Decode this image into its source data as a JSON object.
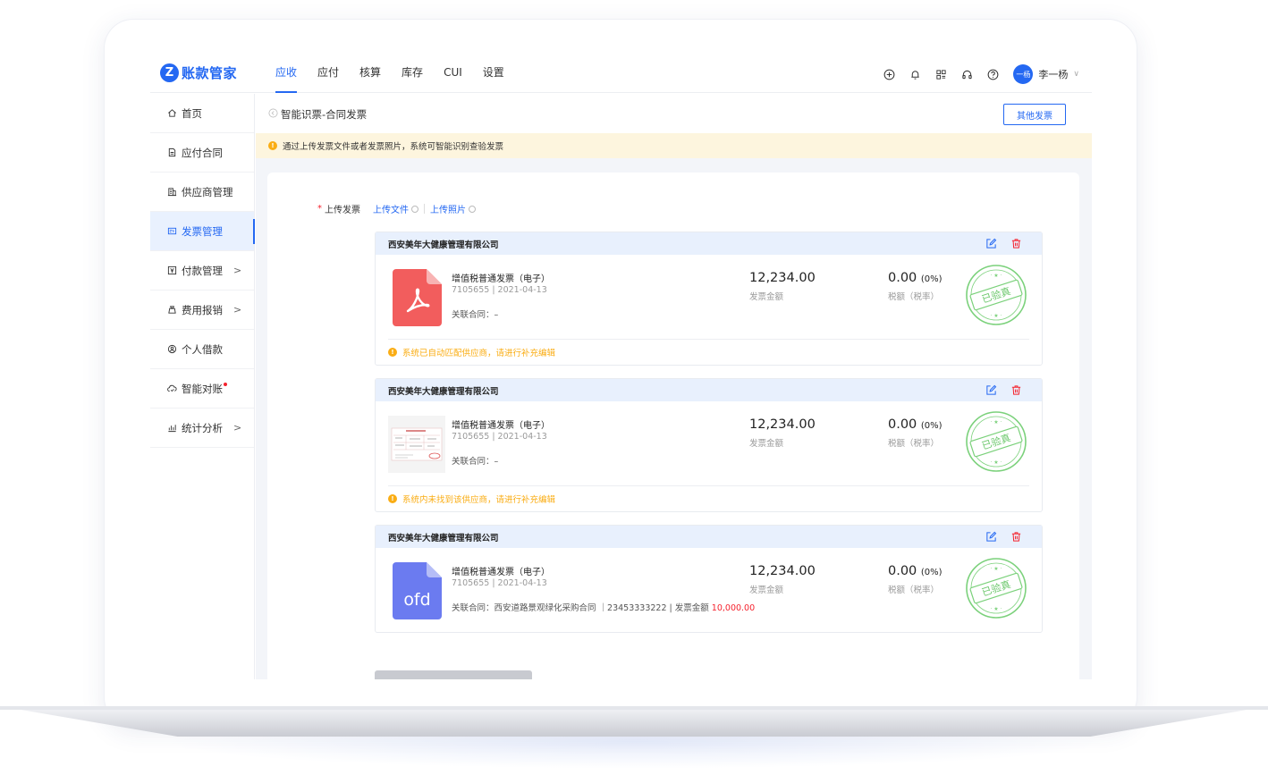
{
  "logo": {
    "mark": "Z",
    "text": "账款管家"
  },
  "nav": {
    "tabs": [
      {
        "label": "应收",
        "active": true
      },
      {
        "label": "应付",
        "active": false
      },
      {
        "label": "核算",
        "active": false
      },
      {
        "label": "库存",
        "active": false
      },
      {
        "label": "CUI",
        "active": false
      },
      {
        "label": "设置",
        "active": false
      }
    ],
    "icons": [
      "add-circle-icon",
      "bell-icon",
      "apps-icon",
      "headset-icon",
      "help-icon"
    ],
    "avatar_text": "一杨",
    "username": "李一杨",
    "caret": "∨"
  },
  "sidebar": {
    "items": [
      {
        "label": "首页",
        "icon": "home-icon",
        "arrow": "",
        "badge": false,
        "active": false
      },
      {
        "label": "应付合同",
        "icon": "document-icon",
        "arrow": "",
        "badge": false,
        "active": false
      },
      {
        "label": "供应商管理",
        "icon": "building-icon",
        "arrow": "",
        "badge": false,
        "active": false
      },
      {
        "label": "发票管理",
        "icon": "invoice-icon",
        "arrow": "",
        "badge": false,
        "active": true
      },
      {
        "label": "付款管理",
        "icon": "yen-icon",
        "arrow": ">",
        "badge": false,
        "active": false
      },
      {
        "label": "费用报销",
        "icon": "wallet-icon",
        "arrow": ">",
        "badge": false,
        "active": false
      },
      {
        "label": "个人借款",
        "icon": "person-money-icon",
        "arrow": "",
        "badge": false,
        "active": false
      },
      {
        "label": "智能对账",
        "icon": "cloud-check-icon",
        "arrow": "",
        "badge": true,
        "active": false
      },
      {
        "label": "统计分析",
        "icon": "chart-icon",
        "arrow": ">",
        "badge": false,
        "active": false
      }
    ]
  },
  "header": {
    "title": "智能识票-合同发票",
    "other_button": "其他发票"
  },
  "notice": {
    "icon": "!",
    "text": "通过上传发票文件或者发票照片，系统可智能识别查验发票"
  },
  "upload": {
    "required_mark": "*",
    "label": "上传发票",
    "file_link": "上传文件",
    "photo_link": "上传照片"
  },
  "invoices": [
    {
      "company": "西安美年大健康管理有限公司",
      "thumb": "pdf",
      "name": "增值税普通发票（电子）",
      "number": "7105655 | 2021-04-13",
      "link_prefix": "关联合同：",
      "link_value": "–",
      "link_amount": "",
      "amount": "12,234.00",
      "amount_label": "发票金额",
      "tax": "0.00",
      "tax_rate": "(0%)",
      "tax_label": "税额（税率）",
      "stamp": "已验真",
      "foot": "系统已自动匹配供应商，请进行补充编辑"
    },
    {
      "company": "西安美年大健康管理有限公司",
      "thumb": "photo",
      "name": "增值税普通发票（电子）",
      "number": "7105655 | 2021-04-13",
      "link_prefix": "关联合同：",
      "link_value": "–",
      "link_amount": "",
      "amount": "12,234.00",
      "amount_label": "发票金额",
      "tax": "0.00",
      "tax_rate": "(0%)",
      "tax_label": "税额（税率）",
      "stamp": "已验真",
      "foot": "系统内未找到该供应商，请进行补充编辑"
    },
    {
      "company": "西安美年大健康管理有限公司",
      "thumb": "ofd",
      "thumb_text": "ofd",
      "name": "增值税普通发票（电子）",
      "number": "7105655 | 2021-04-13",
      "link_prefix": "关联合同：",
      "link_value": "西安道路景观绿化采购合同 ｜23453333222 | 发票金额 ",
      "link_amount": "10,000.00",
      "amount": "12,234.00",
      "amount_label": "发票金额",
      "tax": "0.00",
      "tax_rate": "(0%)",
      "tax_label": "税额（税率）",
      "stamp": "已验真",
      "foot": ""
    }
  ],
  "colors": {
    "primary": "#2468f2",
    "warning": "#faad14",
    "danger": "#f5222d",
    "stamp": "#52c41a",
    "pdf": "#f25d5d",
    "ofd": "#6b7bf0"
  }
}
